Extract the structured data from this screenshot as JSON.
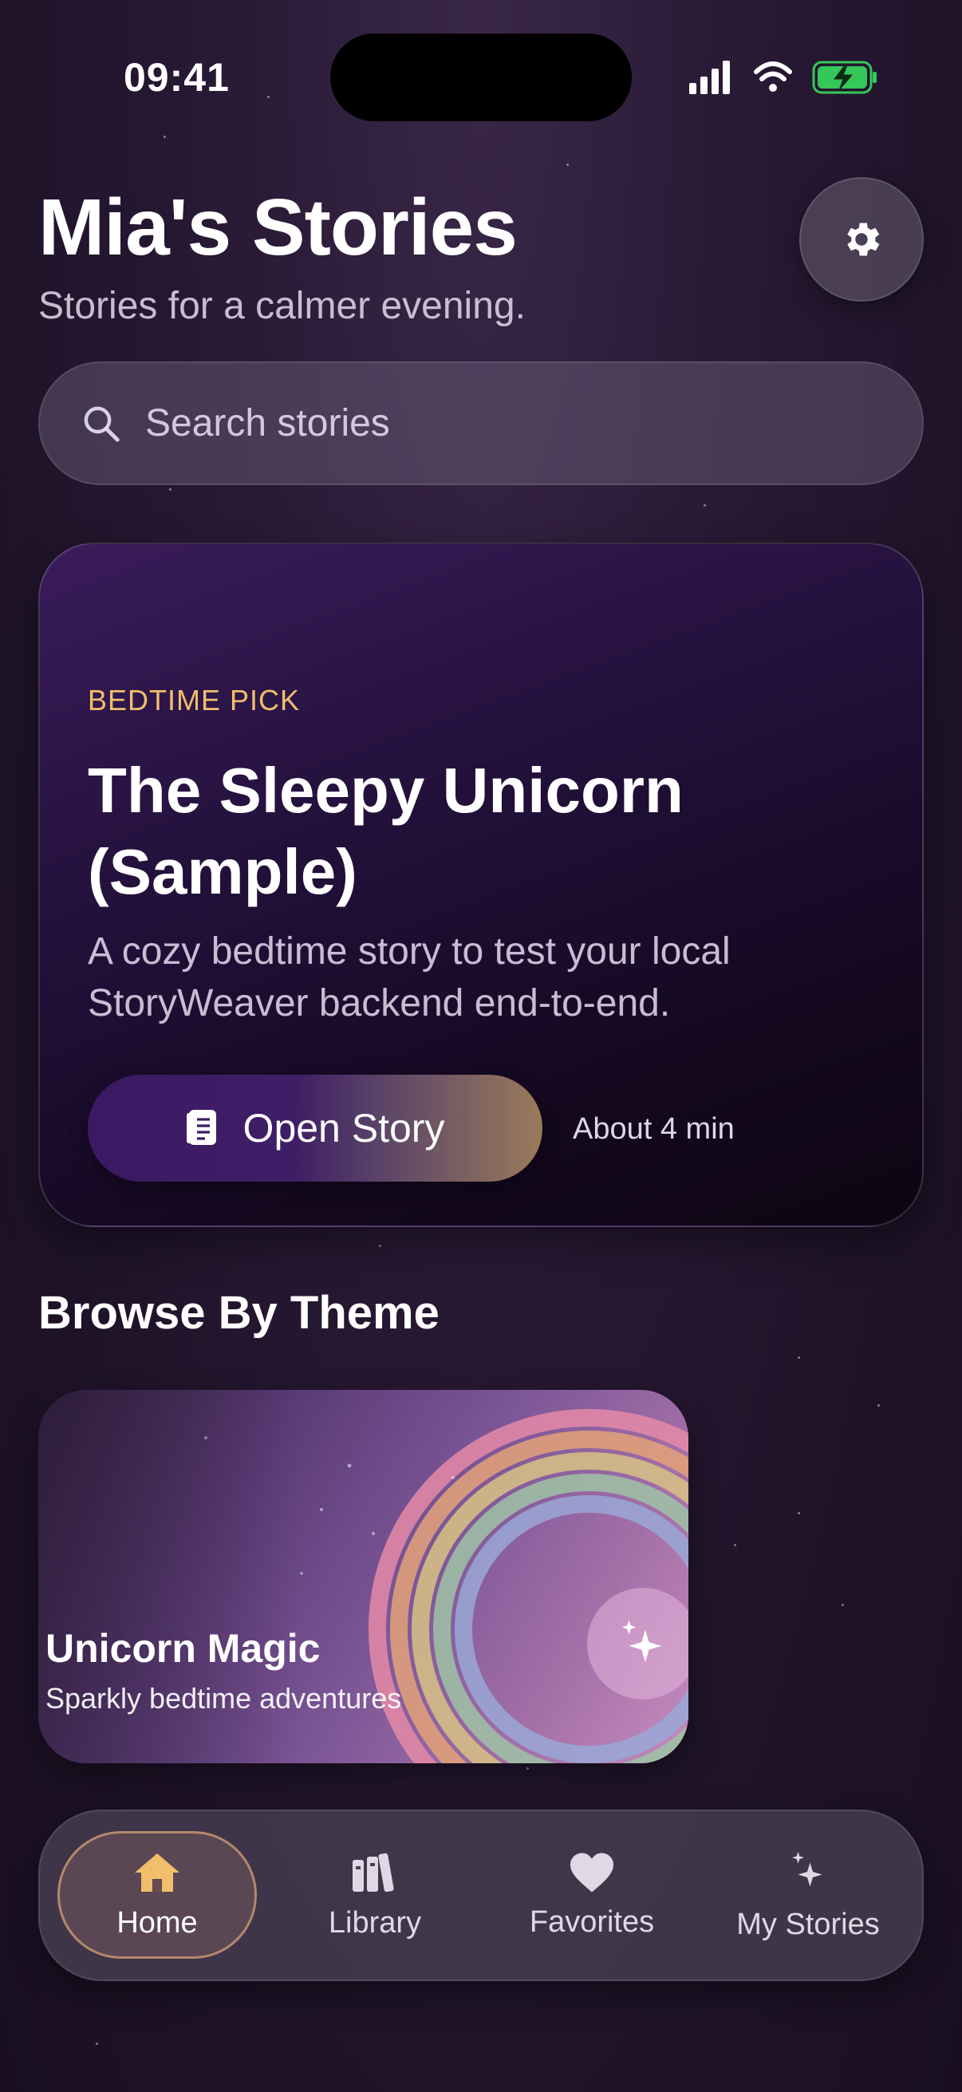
{
  "status_bar": {
    "time": "09:41"
  },
  "header": {
    "title": "Mia's Stories",
    "subtitle": "Stories for a calmer evening."
  },
  "search": {
    "placeholder": "Search stories",
    "value": ""
  },
  "featured": {
    "eyebrow": "BEDTIME PICK",
    "title": "The Sleepy Unicorn (Sample)",
    "description": "A cozy bedtime story to test your local StoryWeaver backend end-to-end.",
    "button_label": "Open Story",
    "duration": "About 4 min"
  },
  "browse": {
    "section_title": "Browse By Theme",
    "themes": [
      {
        "title": "Unicorn Magic",
        "subtitle": "Sparkly bedtime adventures",
        "icon": "sparkles-icon"
      }
    ]
  },
  "tab_bar": {
    "tabs": [
      {
        "label": "Home",
        "icon": "house-icon",
        "active": true
      },
      {
        "label": "Library",
        "icon": "books-icon",
        "active": false
      },
      {
        "label": "Favorites",
        "icon": "heart-icon",
        "active": false
      },
      {
        "label": "My Stories",
        "icon": "sparkles-icon",
        "active": false
      }
    ]
  },
  "colors": {
    "accent_gold": "#f1be6c",
    "battery_green": "#35c759",
    "background": "#2a1a36"
  }
}
